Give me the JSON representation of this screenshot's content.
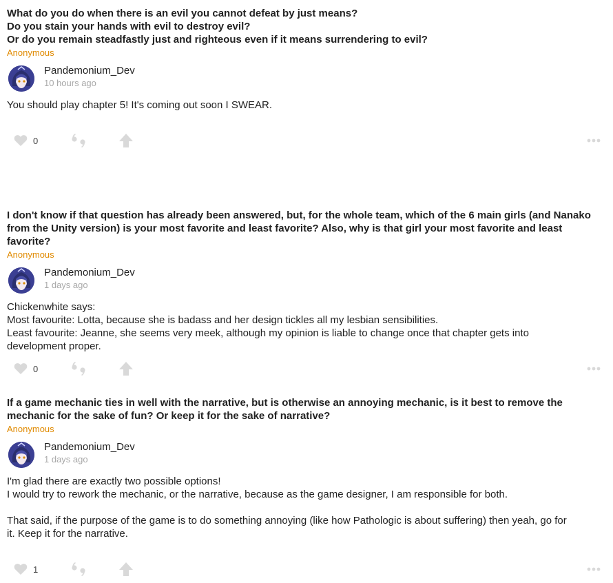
{
  "posts": [
    {
      "question_lines": [
        "What do you do when there is an evil you cannot defeat by just means?",
        "Do you stain your hands with evil to destroy evil?",
        "Or do you remain steadfastly just and righteous even if it means surrendering to evil?"
      ],
      "asker": "Anonymous",
      "author": "Pandemonium_Dev",
      "time": "10 hours ago",
      "answer_lines": [
        "You should play chapter 5! It's coming out soon I SWEAR."
      ],
      "likes": "0"
    },
    {
      "question_lines": [
        "I don't know if that question has already been answered, but, for the whole team, which of the 6 main girls (and Nanako",
        "from the Unity version) is your most favorite and least favorite? Also, why is that girl your most favorite and least favorite?"
      ],
      "asker": "Anonymous",
      "author": "Pandemonium_Dev",
      "time": "1 days ago",
      "answer_lines": [
        "Chickenwhite says:",
        "Most favourite: Lotta, because she is badass and her design tickles all my lesbian sensibilities.",
        "Least favourite: Jeanne, she seems very meek, although my opinion is liable to change once that chapter gets into",
        "development proper."
      ],
      "likes": "0"
    },
    {
      "question_lines": [
        "If a game mechanic ties in well with the narrative, but is otherwise an annoying mechanic, is it best to remove the",
        "mechanic for the sake of fun? Or keep it for the sake of narrative?"
      ],
      "asker": "Anonymous",
      "author": "Pandemonium_Dev",
      "time": "1 days ago",
      "answer_lines": [
        "I'm glad there are exactly two possible options!",
        "I would try to rework the mechanic, or the narrative, because as the game designer, I am responsible for both.",
        "",
        "That said, if the purpose of the game is to do something annoying (like how Pathologic is about suffering) then yeah, go for",
        "it. Keep it for the narrative."
      ],
      "likes": "1"
    }
  ],
  "colors": {
    "accent": "#e08a00",
    "icon": "#d9d9d9",
    "muted": "#a8a8a8",
    "text": "#222222"
  },
  "icons": {
    "like": "heart-icon",
    "comment": "quote-icon",
    "share": "arrow-up-icon",
    "more": "more-dots-icon"
  }
}
